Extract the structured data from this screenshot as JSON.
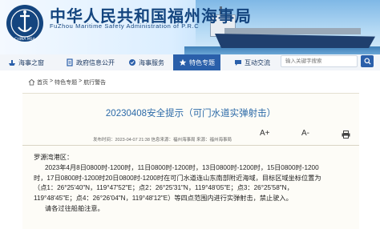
{
  "site": {
    "title_cn": "中华人民共和国福州海事局",
    "title_en": "FuZhou Maritime Safety Administration of P.R.C",
    "logo_text": "CHINA MSA"
  },
  "nav": {
    "items": [
      {
        "label": "海事之窗",
        "icon": "ship-icon"
      },
      {
        "label": "政府信息公开",
        "icon": "document-icon"
      },
      {
        "label": "海事服务",
        "icon": "service-icon"
      },
      {
        "label": "特色专题",
        "icon": "star-icon",
        "active": true
      },
      {
        "label": "互动交流",
        "icon": "chat-icon"
      }
    ],
    "search_placeholder": "输入关键字搜索"
  },
  "breadcrumb": [
    "首页",
    "特色专题",
    "航行警告"
  ],
  "article": {
    "title": "20230408安全提示（可门水道实弹射击）",
    "meta": "发布时间：2023-04-07 21:38  信息来源：福州海事局  来源：福州海事局",
    "font_larger": "A+",
    "font_smaller": "A-",
    "paragraphs": [
      "罗源湾港区：",
      "2023年4月8日0800时-1200时，11日0800时-1200时，13日0800时-1200时，15日0800时-1200",
      "时，17日0800时-1200时20日0800时-1200时在可门水道连山东南部附近海域，目标区域坐标位置为",
      "（点1：26°25'40\"N，119°47'52\"E；点2：26°25'31\"N，119°48'05\"E；点3：26°25'58\"N，",
      "119°48'45\"E；点4：26°26'04\"N，119°48'12\"E）等四点范围内进行实弹射击，禁止驶入。",
      "请各过往船舶注意。"
    ]
  },
  "colors": {
    "brand": "#14457f",
    "nav_active": "#2a5faa",
    "title": "#2c6aa8"
  }
}
